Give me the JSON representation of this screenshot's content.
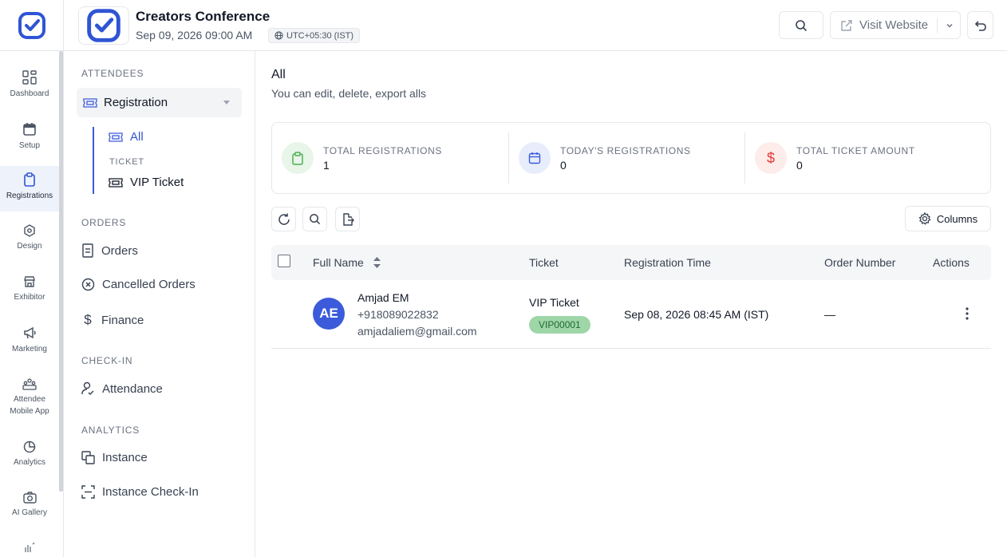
{
  "rail": {
    "items": [
      {
        "label": "Dashboard",
        "icon": "dashboard-icon"
      },
      {
        "label": "Setup",
        "icon": "calendar-icon"
      },
      {
        "label": "Registrations",
        "icon": "clipboard-icon",
        "active": true
      },
      {
        "label": "Design",
        "icon": "design-icon"
      },
      {
        "label": "Exhibitor",
        "icon": "store-icon"
      },
      {
        "label": "Marketing",
        "icon": "megaphone-icon"
      },
      {
        "label": "Attendee Mobile App",
        "icon": "people-icon"
      },
      {
        "label": "Analytics",
        "icon": "pie-chart-icon"
      },
      {
        "label": "AI Gallery",
        "icon": "camera-icon"
      }
    ]
  },
  "header": {
    "title": "Creators Conference",
    "date": "Sep 09, 2026 09:00 AM",
    "timezone": "UTC+05:30 (IST)",
    "visit_label": "Visit Website"
  },
  "sidebar": {
    "attendees_title": "ATTENDEES",
    "registration_label": "Registration",
    "all_label": "All",
    "ticket_title": "TICKET",
    "vip_label": "VIP Ticket",
    "orders_title": "ORDERS",
    "orders_label": "Orders",
    "cancelled_label": "Cancelled Orders",
    "finance_label": "Finance",
    "checkin_title": "CHECK-IN",
    "attendance_label": "Attendance",
    "analytics_title": "ANALYTICS",
    "instance_label": "Instance",
    "instance_checkin_label": "Instance Check-In"
  },
  "main": {
    "title": "All",
    "subtitle": "You can edit, delete, export alls",
    "stats": [
      {
        "label": "TOTAL REGISTRATIONS",
        "value": "1",
        "color": "#4caf50"
      },
      {
        "label": "TODAY'S REGISTRATIONS",
        "value": "0",
        "color": "#3b5bdb"
      },
      {
        "label": "TOTAL TICKET AMOUNT",
        "value": "0",
        "color": "#e53935"
      }
    ],
    "columns_label": "Columns",
    "table": {
      "headers": [
        "Full Name",
        "Ticket",
        "Registration Time",
        "Order Number",
        "Actions"
      ],
      "rows": [
        {
          "initials": "AE",
          "name": "Amjad EM",
          "phone": "+918089022832",
          "email": "amjadaliem@gmail.com",
          "ticket": "VIP Ticket",
          "ticket_code": "VIP00001",
          "time": "Sep 08, 2026 08:45 AM (IST)",
          "order": "—"
        }
      ]
    }
  },
  "colors": {
    "accent": "#3b5bdb",
    "badge_bg": "#9ed6a7"
  }
}
